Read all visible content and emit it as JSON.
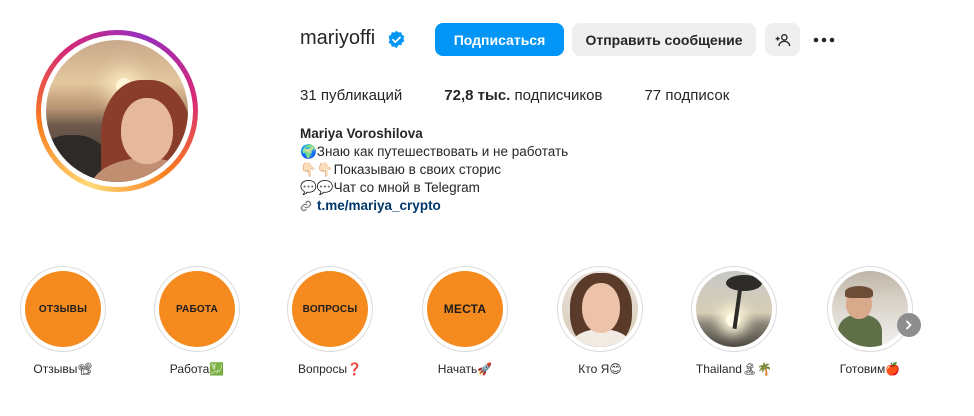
{
  "profile": {
    "username": "mariyoffi",
    "verified": true,
    "follow_label": "Подписаться",
    "message_label": "Отправить сообщение",
    "stats": {
      "posts_count": "31",
      "posts_label": "публикаций",
      "followers_count": "72,8 тыс.",
      "followers_label": "подписчиков",
      "following_count": "77",
      "following_label": "подписок"
    },
    "bio": {
      "name": "Mariya Voroshilova",
      "line1": "🌍Знаю как путешествовать и не работать",
      "line2": "👇🏻👇🏻Показываю в своих сторис",
      "line3": "💬💬Чат со мной в Telegram",
      "link": "t.me/mariya_crypto"
    }
  },
  "highlights": [
    {
      "cover_text": "ОТЗЫВЫ",
      "label": "Отзывы📽"
    },
    {
      "cover_text": "РАБОТА",
      "label": "Работа💹"
    },
    {
      "cover_text": "ВОПРОСЫ",
      "label": "Вопросы❓"
    },
    {
      "cover_text": "МЕСТА",
      "label": "Начать🚀"
    },
    {
      "cover_text": "",
      "label": "Кто Я😊"
    },
    {
      "cover_text": "",
      "label": "Thailand🏝🌴"
    },
    {
      "cover_text": "",
      "label": "Готовим🍎"
    }
  ],
  "colors": {
    "primary_button": "#0095f6",
    "secondary_button": "#efefef",
    "highlight_orange": "#f58a1f",
    "link": "#00376b"
  },
  "icons": {
    "verified": "verified-badge-icon",
    "add_user": "add-user-icon",
    "more": "more-horizontal-icon",
    "link": "link-icon",
    "next": "chevron-right-icon"
  }
}
